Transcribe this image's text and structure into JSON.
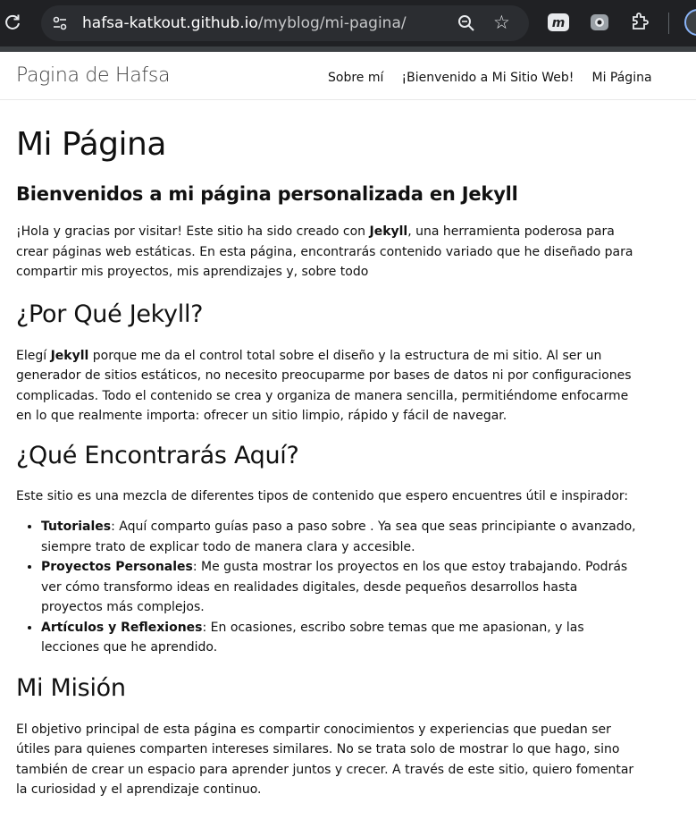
{
  "browser": {
    "url_host": "hafsa-katkout.github.io",
    "url_path": "/myblog/mi-pagina/"
  },
  "site": {
    "title": "Pagina de Hafsa",
    "nav": [
      "Sobre mí",
      "¡Bienvenido a Mi Sitio Web!",
      "Mi Página"
    ]
  },
  "page": {
    "title": "Mi Página",
    "subtitle": "Bienvenidos a mi página personalizada en Jekyll",
    "intro_before": "¡Hola y gracias por visitar! Este sitio ha sido creado con ",
    "intro_bold": "Jekyll",
    "intro_after": ", una herramienta poderosa para crear páginas web estáticas. En esta página, encontrarás contenido variado que he diseñado para compartir mis proyectos, mis aprendizajes y, sobre todo",
    "section1_title": "¿Por Qué Jekyll?",
    "section1_before": "Elegí ",
    "section1_bold": "Jekyll",
    "section1_after": " porque me da el control total sobre el diseño y la estructura de mi sitio. Al ser un generador de sitios estáticos, no necesito preocuparme por bases de datos ni por configuraciones complicadas. Todo el contenido se crea y organiza de manera sencilla, permitiéndome enfocarme en lo que realmente importa: ofrecer un sitio limpio, rápido y fácil de navegar.",
    "section2_title": "¿Qué Encontrarás Aquí?",
    "section2_intro": "Este sitio es una mezcla de diferentes tipos de contenido que espero encuentres útil e inspirador:",
    "items": [
      {
        "bold": "Tutoriales",
        "text": ": Aquí comparto guías paso a paso sobre . Ya sea que seas principiante o avanzado, siempre trato de explicar todo de manera clara y accesible."
      },
      {
        "bold": "Proyectos Personales",
        "text": ": Me gusta mostrar los proyectos en los que estoy trabajando. Podrás ver cómo transformo ideas en realidades digitales, desde pequeños desarrollos hasta proyectos más complejos."
      },
      {
        "bold": "Artículos y Reflexiones",
        "text": ": En ocasiones, escribo sobre temas que me apasionan, y las lecciones que he aprendido."
      }
    ],
    "section3_title": "Mi Misión",
    "section3_text": "El objetivo principal de esta página es compartir conocimientos y experiencias que puedan ser útiles para quienes comparten intereses similares. No se trata solo de mostrar lo que hago, sino también de crear un espacio para aprender juntos y crecer. A través de este sitio, quiero fomentar la curiosidad y el aprendizaje continuo."
  }
}
